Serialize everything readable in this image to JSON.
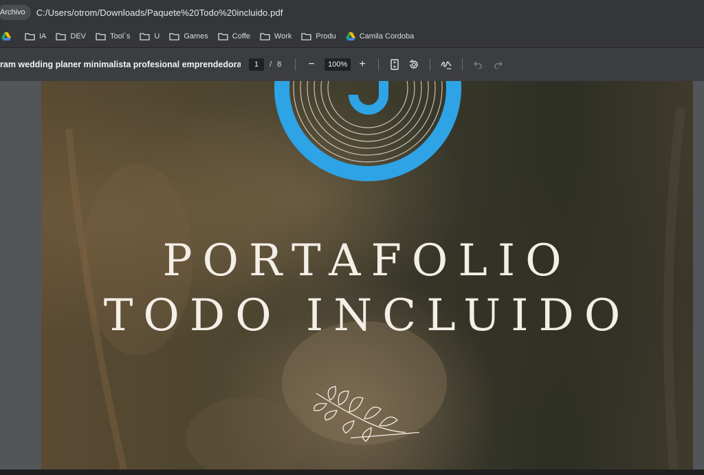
{
  "address_bar": {
    "chip_label": "Archivo",
    "url": "C:/Users/otrom/Downloads/Paquete%20Todo%20incluido.pdf"
  },
  "bookmarks": [
    {
      "label": "",
      "icon": "drive-icon"
    },
    {
      "label": "IA",
      "icon": "folder-icon"
    },
    {
      "label": "DEV",
      "icon": "folder-icon"
    },
    {
      "label": "Tool`s",
      "icon": "folder-icon"
    },
    {
      "label": "U",
      "icon": "folder-icon"
    },
    {
      "label": "Games",
      "icon": "folder-icon"
    },
    {
      "label": "Coffe",
      "icon": "folder-icon"
    },
    {
      "label": "Work",
      "icon": "folder-icon"
    },
    {
      "label": "Produ",
      "icon": "folder-icon"
    },
    {
      "label": "Camila Cordoba",
      "icon": "drive-icon"
    }
  ],
  "pdf_toolbar": {
    "title": "ram wedding planer minimalista profesional emprendedora ...",
    "page_current": "1",
    "page_separator": "/",
    "page_total": "8",
    "zoom_out": "−",
    "zoom": "100%",
    "zoom_in": "+"
  },
  "document": {
    "line1": "PORTAFOLIO",
    "line2": "TODO INCLUIDO",
    "accent_color": "#2ea3e6"
  }
}
